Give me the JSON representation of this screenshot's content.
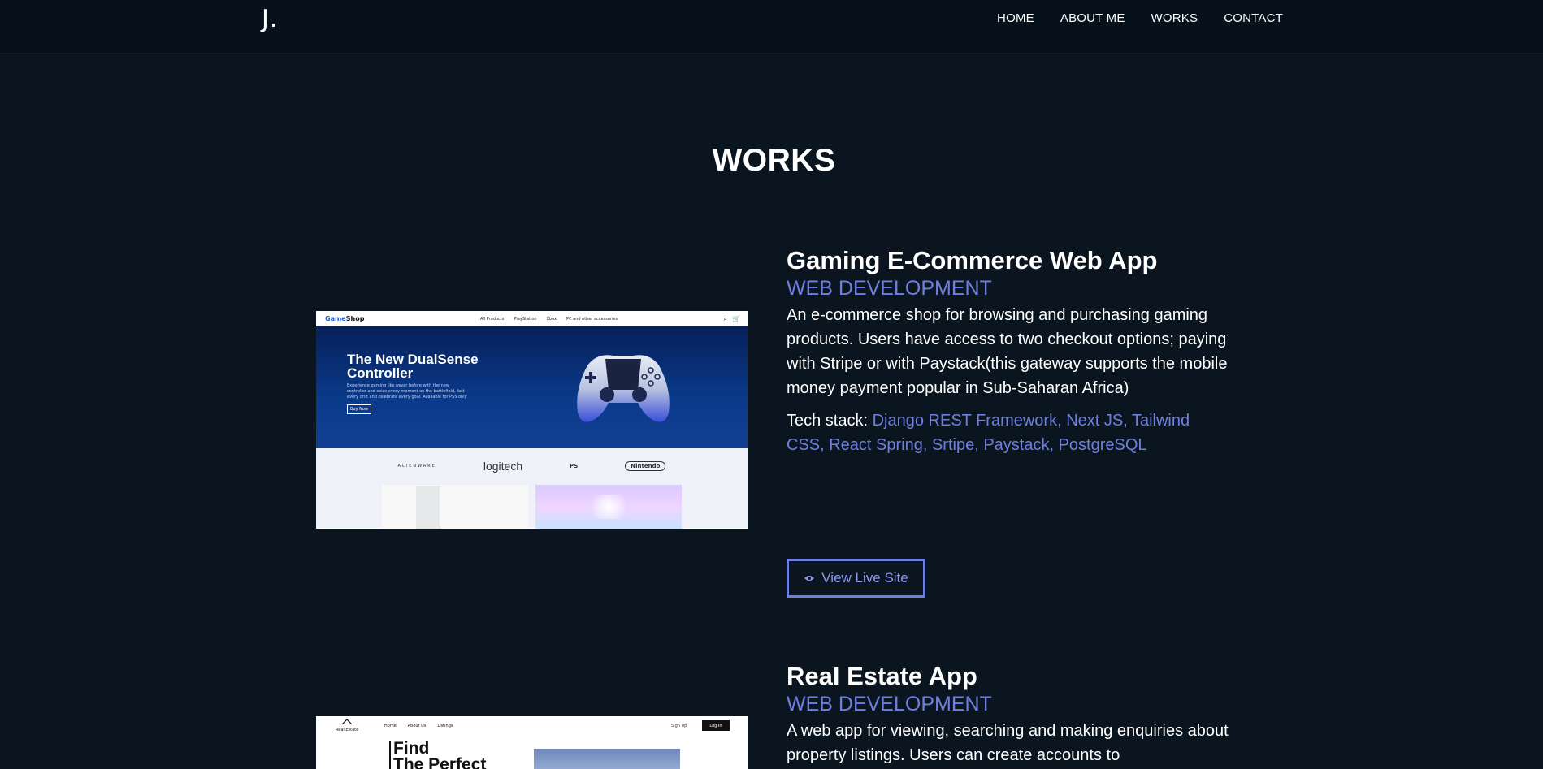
{
  "header": {
    "logo": "J.",
    "nav": [
      "HOME",
      "ABOUT ME",
      "WORKS",
      "CONTACT"
    ]
  },
  "section_title": "WORKS",
  "projects": [
    {
      "title": "Gaming E-Commerce Web App",
      "category": "WEB DEVELOPMENT",
      "description": "An e-commerce shop for browsing and purchasing gaming products. Users have access to two checkout options; paying with Stripe or with Paystack(this gateway supports the mobile money payment popular in Sub-Saharan Africa)",
      "tech_label": "Tech stack: ",
      "tech_list": "Django REST Framework, Next JS, Tailwind CSS, React Spring, Srtipe, Paystack, PostgreSQL",
      "button_label": "View Live Site",
      "screenshot": {
        "logo_prefix": "Game",
        "logo_suffix": "Shop",
        "nav": [
          "All Products",
          "PlayStation",
          "Xbox",
          "PC and other accessories"
        ],
        "hero_title": "The New DualSense Controller",
        "hero_sub": "Experience gaming like never before with the new controller and seize every moment on the battlefield, fast every drift and celebrate every goal. Available for PS5 only",
        "hero_button": "Buy Now",
        "brands": [
          "ALIENWARE",
          "logitech",
          "PS",
          "Nintendo"
        ]
      }
    },
    {
      "title": "Real Estate App",
      "category": "WEB DEVELOPMENT",
      "description": "A web app for viewing, searching and making enquiries about property listings. Users can create accounts to",
      "screenshot": {
        "logo": "Real Estate",
        "nav": [
          "Home",
          "About Us",
          "Listings"
        ],
        "signup": "Sign Up",
        "login": "Log In",
        "heading_line1": "Find",
        "heading_line2": "The Perfect"
      }
    }
  ],
  "colors": {
    "background": "#0a1520",
    "header": "#07111b",
    "accent": "#6f7fe0"
  }
}
